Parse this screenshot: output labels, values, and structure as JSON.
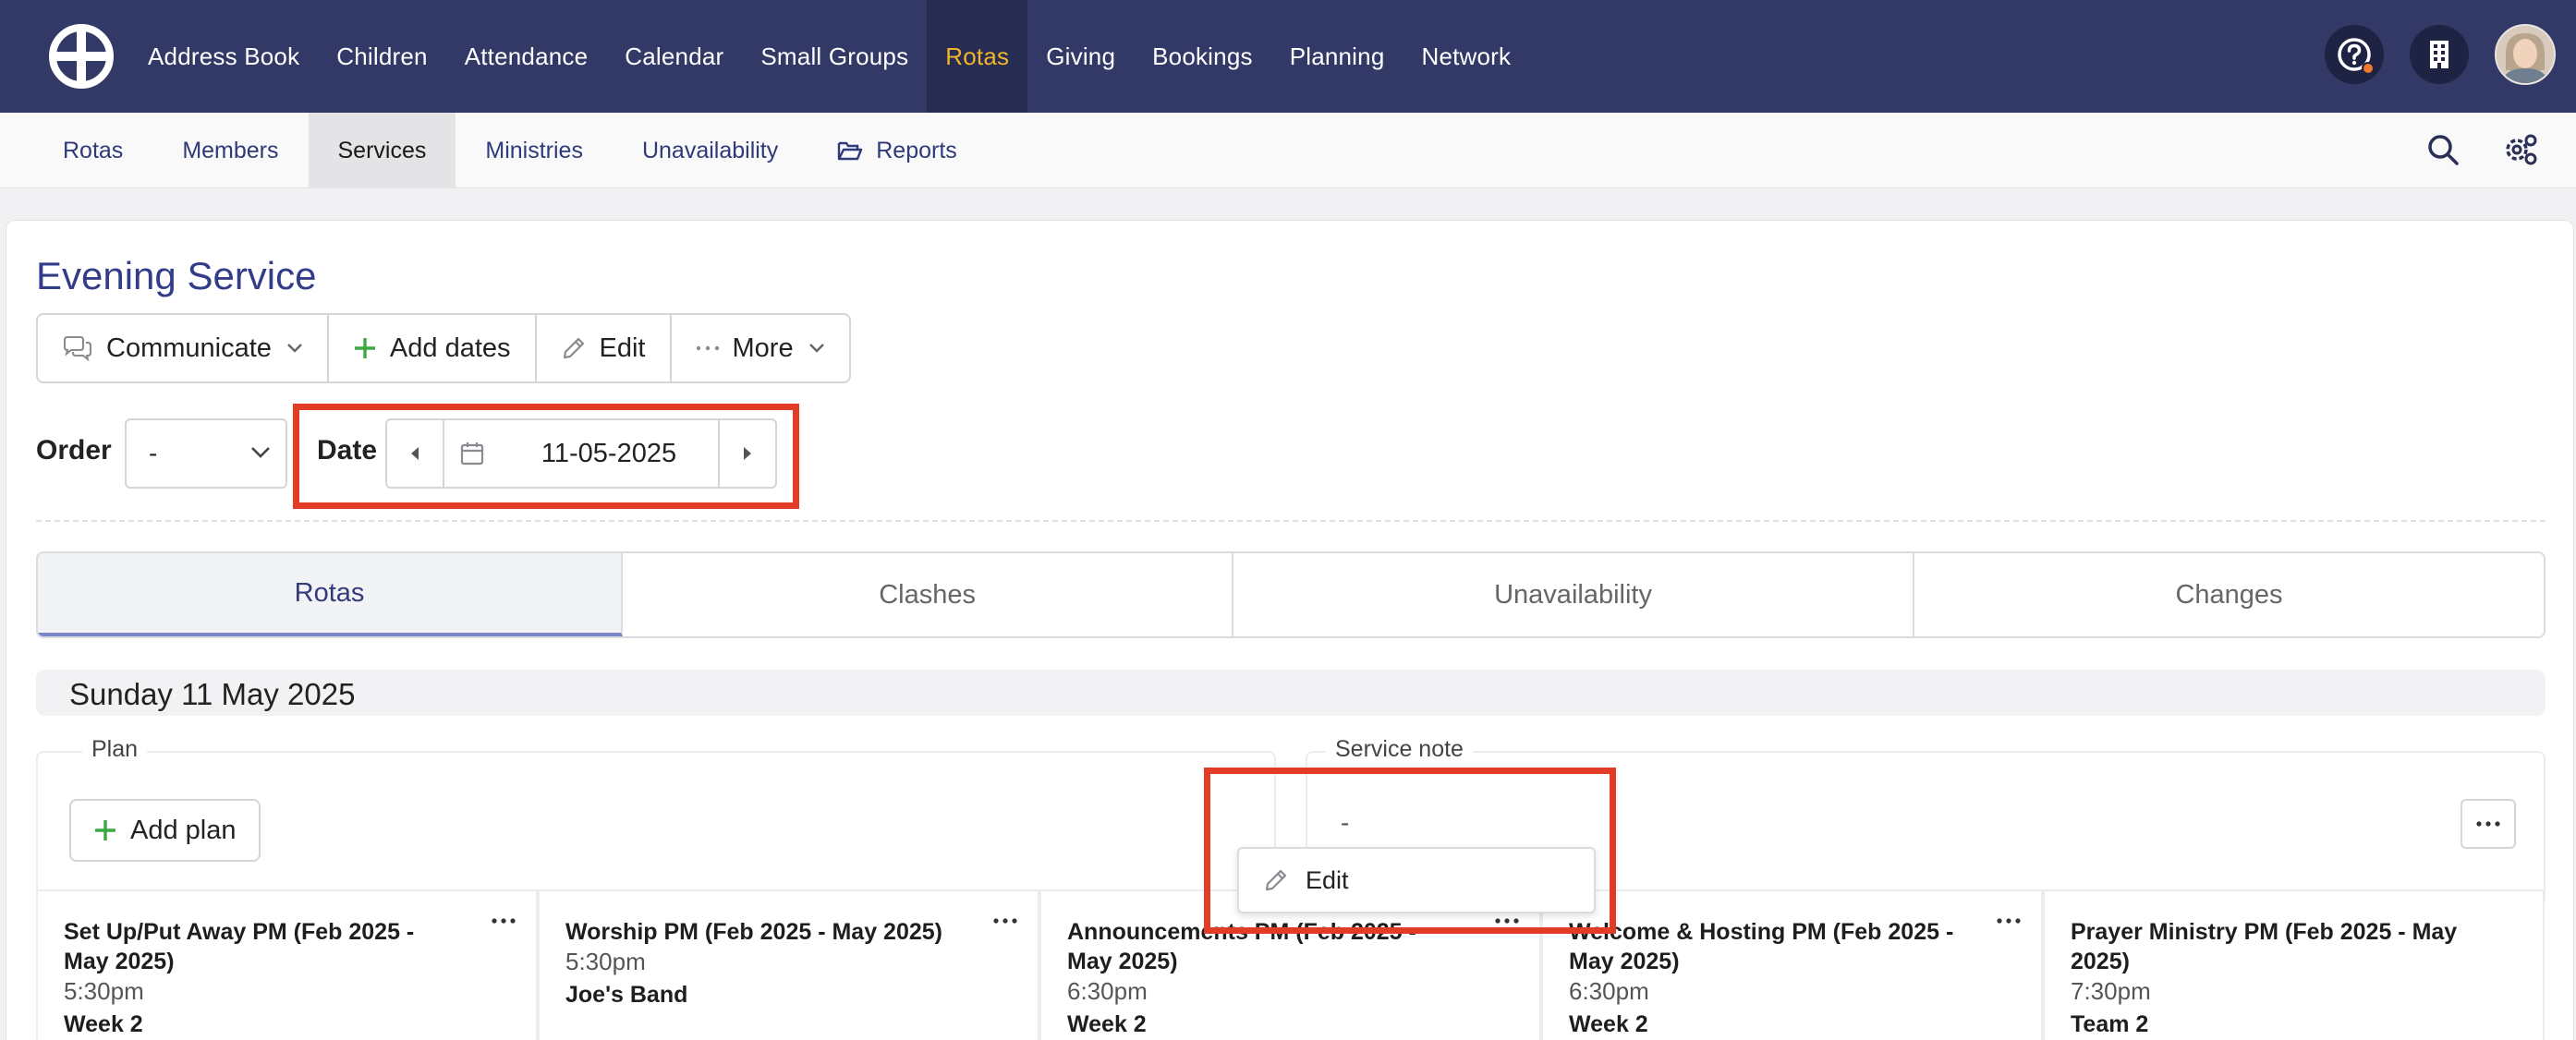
{
  "nav": {
    "items": [
      "Address Book",
      "Children",
      "Attendance",
      "Calendar",
      "Small Groups",
      "Rotas",
      "Giving",
      "Bookings",
      "Planning",
      "Network"
    ],
    "active": "Rotas"
  },
  "subnav": {
    "items": [
      "Rotas",
      "Members",
      "Services",
      "Ministries",
      "Unavailability",
      "Reports"
    ],
    "active": "Services"
  },
  "page": {
    "title": "Evening Service",
    "toolbar": {
      "communicate": "Communicate",
      "add_dates": "Add dates",
      "edit": "Edit",
      "more": "More"
    },
    "order_label": "Order",
    "order_value": "-",
    "date_label": "Date",
    "date_value": "11-05-2025"
  },
  "tabs": [
    "Rotas",
    "Clashes",
    "Unavailability",
    "Changes"
  ],
  "day": {
    "heading": "Sunday 11 May 2025",
    "plan_label": "Plan",
    "add_plan": "Add plan",
    "service_note_label": "Service note",
    "service_note_value": "-",
    "menu_edit": "Edit"
  },
  "rotas": [
    {
      "title": "Set Up/Put Away PM (Feb 2025 - May 2025)",
      "time": "5:30pm",
      "sub": "Week 2"
    },
    {
      "title": "Worship PM (Feb 2025 - May 2025)",
      "time": "5:30pm",
      "sub": "Joe's Band"
    },
    {
      "title": "Announcements PM (Feb 2025 - May 2025)",
      "time": "6:30pm",
      "sub": "Week 2"
    },
    {
      "title": "Welcome & Hosting PM (Feb 2025 - May 2025)",
      "time": "6:30pm",
      "sub": "Week 2"
    },
    {
      "title": "Prayer Ministry PM (Feb 2025 - May 2025)",
      "time": "7:30pm",
      "sub": "Team 2"
    }
  ],
  "colors": {
    "nav_bg": "#323966",
    "accent_active": "#f1b52a",
    "title": "#323c88",
    "highlight": "#e13c25",
    "add_icon": "#3aa843"
  }
}
